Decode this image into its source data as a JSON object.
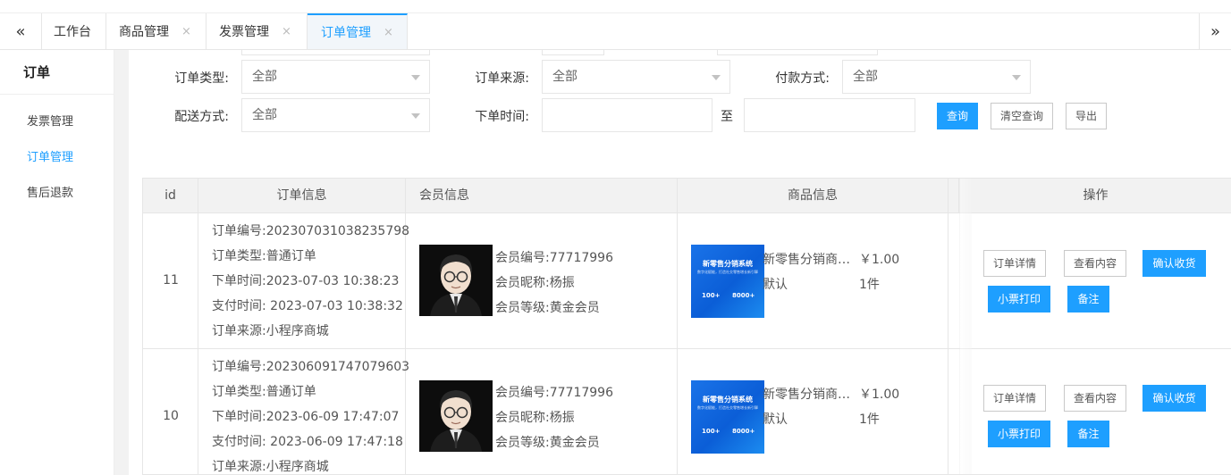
{
  "tabs": {
    "prev_icon": "«",
    "next_icon": "»",
    "items": [
      {
        "label": "工作台",
        "closable": false
      },
      {
        "label": "商品管理",
        "closable": true
      },
      {
        "label": "发票管理",
        "closable": true
      },
      {
        "label": "订单管理",
        "closable": true,
        "active": true
      }
    ],
    "close_glyph": "×"
  },
  "sidebar": {
    "title": "订单",
    "items": [
      {
        "label": "发票管理"
      },
      {
        "label": "订单管理",
        "active": true
      },
      {
        "label": "售后退款"
      }
    ]
  },
  "filters": {
    "order_type": {
      "label": "订单类型:",
      "value": "全部"
    },
    "order_source": {
      "label": "订单来源:",
      "value": "全部"
    },
    "pay_method": {
      "label": "付款方式:",
      "value": "全部"
    },
    "delivery": {
      "label": "配送方式:",
      "value": "全部"
    },
    "order_time": {
      "label": "下单时间:",
      "to": "至"
    },
    "buttons": {
      "query": "查询",
      "clear": "清空查询",
      "export": "导出"
    }
  },
  "table": {
    "headers": {
      "id": "id",
      "order": "订单信息",
      "member": "会员信息",
      "product": "商品信息",
      "ops": "操作"
    },
    "rows": [
      {
        "id": "11",
        "order_no": "订单编号:202307031038235798",
        "order_type": "订单类型:普通订单",
        "order_time": "下单时间:2023-07-03 10:38:23",
        "pay_time": "支付时间: 2023-07-03 10:38:32",
        "source": "订单来源:小程序商城",
        "member_no": "会员编号:77717996",
        "member_nick": "会员昵称:杨振",
        "member_level": "会员等级:黄金会员",
        "product_name": "新零售分销商…",
        "product_price": "￥1.00",
        "product_sku": "默认",
        "product_qty": "1件",
        "product_img_title": "新零售分销系统",
        "product_img_sub": "数字化赋能，打造社交零售增长新引擎",
        "product_img_n1": "100+",
        "product_img_n2": "8000+"
      },
      {
        "id": "10",
        "order_no": "订单编号:202306091747079603",
        "order_type": "订单类型:普通订单",
        "order_time": "下单时间:2023-06-09 17:47:07",
        "pay_time": "支付时间: 2023-06-09 17:47:18",
        "source": "订单来源:小程序商城",
        "member_no": "会员编号:77717996",
        "member_nick": "会员昵称:杨振",
        "member_level": "会员等级:黄金会员",
        "product_name": "新零售分销商…",
        "product_price": "￥1.00",
        "product_sku": "默认",
        "product_qty": "1件",
        "product_img_title": "新零售分销系统",
        "product_img_sub": "数字化赋能，打造社交零售增长新引擎",
        "product_img_n1": "100+",
        "product_img_n2": "8000+"
      }
    ],
    "ops": {
      "detail": "订单详情",
      "view": "查看内容",
      "confirm": "确认收货",
      "print": "小票打印",
      "note": "备注"
    }
  },
  "colors": {
    "accent": "#1e9fff",
    "border": "#e6e6e6",
    "header_bg": "#f2f2f2"
  }
}
